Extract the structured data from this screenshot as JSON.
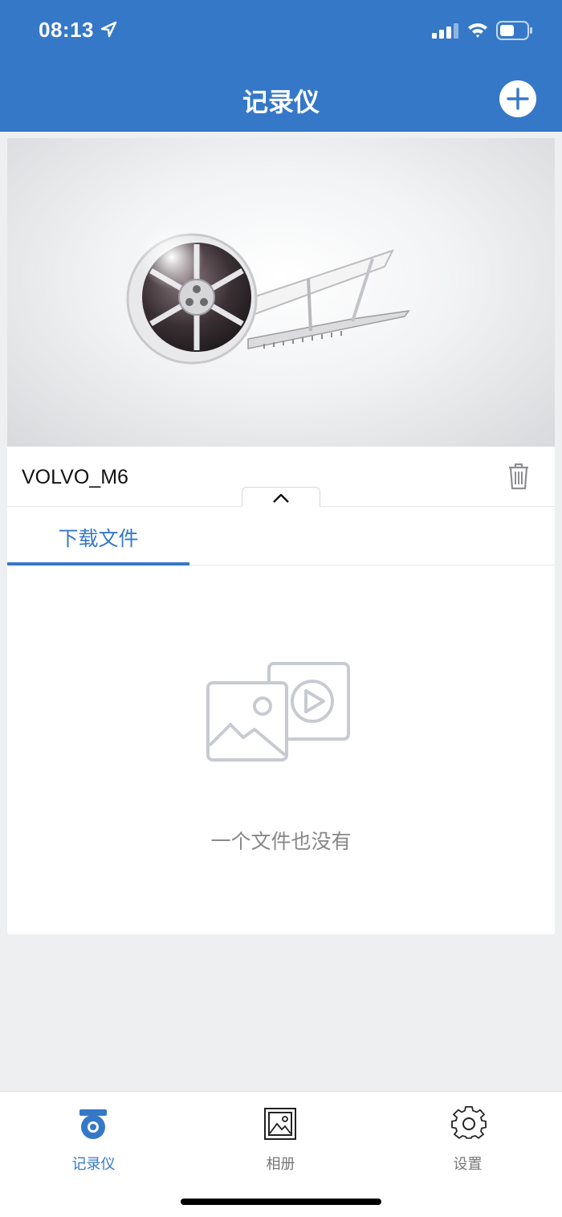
{
  "status_bar": {
    "time": "08:13"
  },
  "nav": {
    "title": "记录仪",
    "add_icon": "plus-circle-icon"
  },
  "device": {
    "name": "VOLVO_M6",
    "delete_icon": "trash-icon"
  },
  "tabs": [
    {
      "label": "下载文件",
      "active": true
    }
  ],
  "empty_state": {
    "message": "一个文件也没有",
    "icon": "image-video-placeholder-icon"
  },
  "bottom_nav": [
    {
      "label": "记录仪",
      "icon": "dashcam-icon",
      "active": true
    },
    {
      "label": "相册",
      "icon": "album-icon",
      "active": false
    },
    {
      "label": "设置",
      "icon": "gear-icon",
      "active": false
    }
  ],
  "colors": {
    "primary": "#3578c7",
    "background": "#eeeff1",
    "inactive": "#777777"
  }
}
